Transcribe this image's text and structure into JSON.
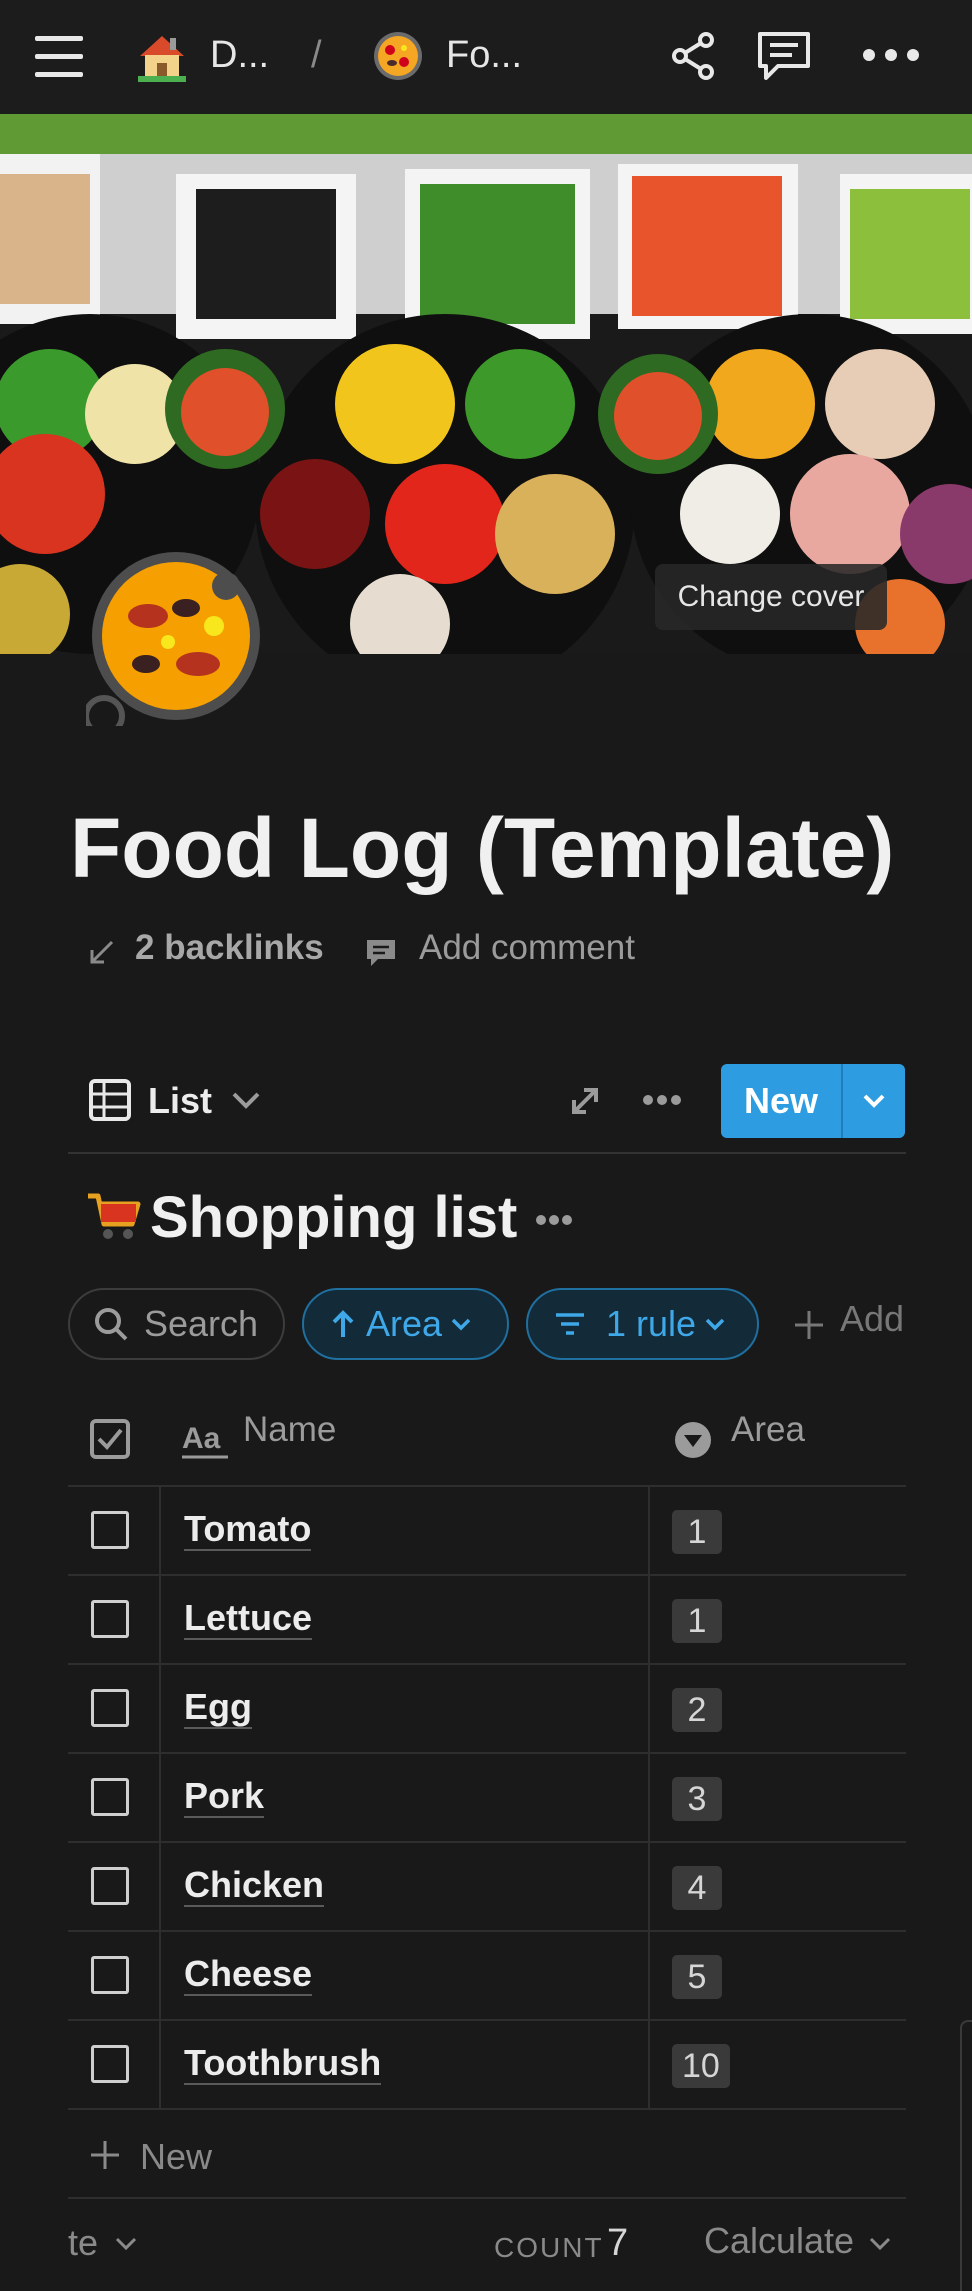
{
  "topbar": {
    "crumb1": "D...",
    "crumb_sep": "/",
    "crumb2": "Fo..."
  },
  "cover": {
    "change_cover_label": "Change cover"
  },
  "page": {
    "title": "Food Log (Template)",
    "backlinks": "2 backlinks",
    "add_comment": "Add comment"
  },
  "view": {
    "label": "List",
    "new_label": "New"
  },
  "database": {
    "title": "Shopping list",
    "search_label": "Search",
    "sort_chip": "Area",
    "filter_chip": "1 rule",
    "add_filter": "Add",
    "columns": {
      "name": "Name",
      "area": "Area"
    },
    "rows": [
      {
        "name": "Tomato",
        "area": "1"
      },
      {
        "name": "Lettuce",
        "area": "1"
      },
      {
        "name": "Egg",
        "area": "2"
      },
      {
        "name": "Pork",
        "area": "3"
      },
      {
        "name": "Chicken",
        "area": "4"
      },
      {
        "name": "Cheese",
        "area": "5"
      },
      {
        "name": "Toothbrush",
        "area": "10"
      }
    ],
    "new_row_label": "New",
    "footer": {
      "left": "te",
      "count_label": "COUNT",
      "count_value": "7",
      "calculate": "Calculate"
    }
  },
  "colors": {
    "background": "#191919",
    "accent": "#2d9ce0",
    "chip_blue": "#3ea8e8"
  },
  "icons": [
    "menu-icon",
    "house-emoji-icon",
    "paella-emoji-icon",
    "share-icon",
    "comment-icon",
    "more-icon",
    "backlink-arrow-icon",
    "comment-bubble-icon",
    "table-icon",
    "chevron-down-icon",
    "expand-icon",
    "cart-emoji-icon",
    "search-icon",
    "arrow-up-icon",
    "filter-lines-icon",
    "plus-icon",
    "checkbox-header-icon",
    "text-aa-icon",
    "select-property-icon"
  ]
}
